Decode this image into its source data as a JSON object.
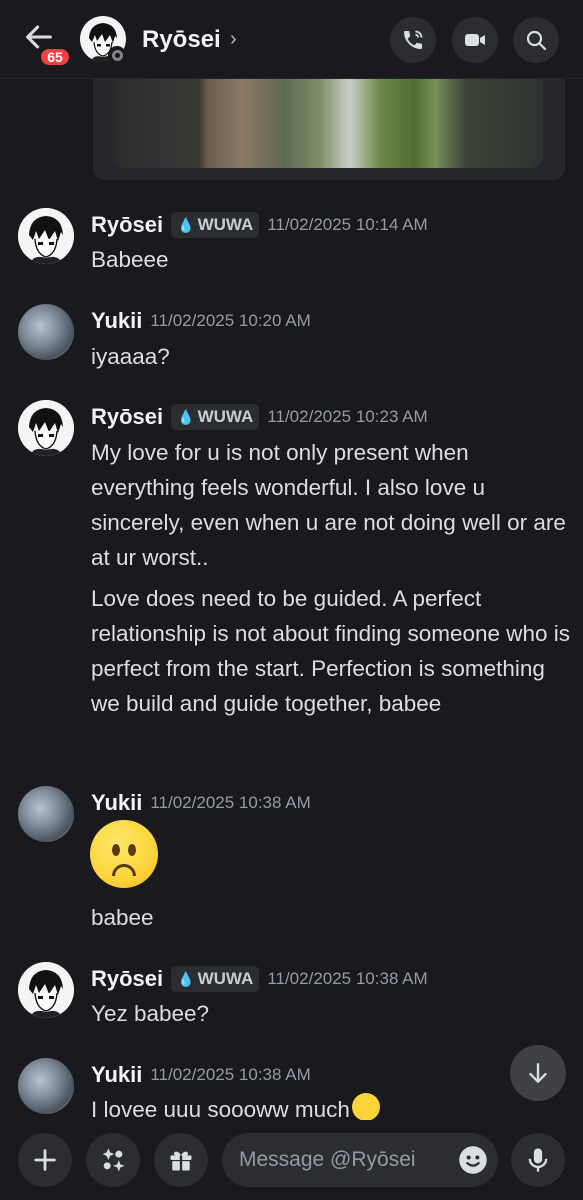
{
  "header": {
    "back_badge": "65",
    "title": "Ryōsei",
    "title_chevron": "›",
    "icons": [
      "phone-call-icon",
      "video-camera-icon",
      "search-icon"
    ]
  },
  "media": {
    "type": "image-attachment"
  },
  "messages": [
    {
      "author": "Ryōsei",
      "tag": "WUWA",
      "tag_icon": "water-drop-icon",
      "time": "11/02/2025 10:14 AM",
      "lines": [
        "Babeee"
      ]
    },
    {
      "author": "Yukii",
      "time": "11/02/2025 10:20 AM",
      "lines": [
        "iyaaaa?"
      ]
    },
    {
      "author": "Ryōsei",
      "tag": "WUWA",
      "tag_icon": "water-drop-icon",
      "time": "11/02/2025 10:23 AM",
      "lines": [
        "My love for u is not only present when everything feels wonderful. I also love u sincerely, even when u are not doing well or are at ur worst..",
        "Love does need to be guided. A perfect relationship is not about finding someone who is perfect from the start. Perfection is something we build and guide together, babee"
      ]
    },
    {
      "author": "Yukii",
      "time": "11/02/2025 10:38 AM",
      "emoji": "frowning-face-emoji",
      "lines": [
        "babee"
      ]
    },
    {
      "author": "Ryōsei",
      "tag": "WUWA",
      "tag_icon": "water-drop-icon",
      "time": "11/02/2025 10:38 AM",
      "lines": [
        "Yez babee?"
      ]
    },
    {
      "author": "Yukii",
      "time": "11/02/2025 10:38 AM",
      "lines": [
        "I lovee uuu soooww much"
      ],
      "trailing_emoji": "crying-face-emoji"
    }
  ],
  "composer": {
    "placeholder": "Message @Ryōsei",
    "icons": [
      "plus-icon",
      "apps-icon",
      "gift-icon",
      "emoji-icon",
      "microphone-icon"
    ]
  },
  "colors": {
    "background": "#1a1a1e",
    "surface": "#2b2d31",
    "text": "#dbdee1",
    "muted": "#949ba4",
    "badge": "#f23f43"
  }
}
